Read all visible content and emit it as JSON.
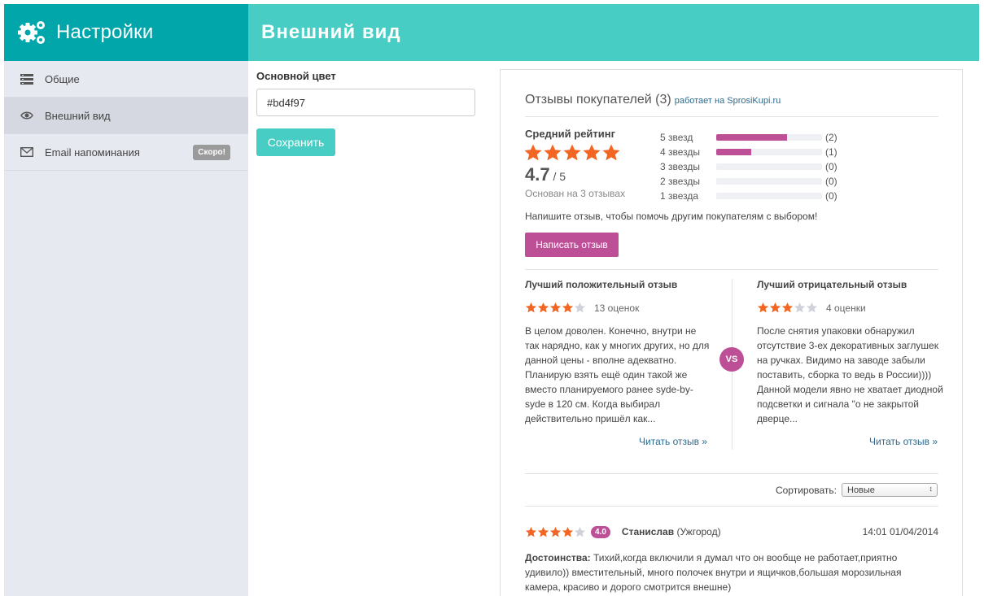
{
  "sidebar": {
    "title": "Настройки",
    "items": [
      {
        "label": "Общие",
        "icon": "list-icon"
      },
      {
        "label": "Внешний вид",
        "icon": "eye-icon",
        "active": true
      },
      {
        "label": "Email напоминания",
        "icon": "mail-icon",
        "badge": "Скоро!"
      }
    ]
  },
  "header": {
    "title": "Внешний вид"
  },
  "form": {
    "color_label": "Основной цвет",
    "color_value": "#bd4f97",
    "save_label": "Сохранить"
  },
  "widget": {
    "title": "Отзывы покупателей (3)",
    "powered": "работает на SprosiKupi.ru",
    "accent_color": "#bd4f97",
    "star_color": "#f26522",
    "avg_label": "Средний рейтинг",
    "avg_score": "4.7",
    "avg_of": " / 5",
    "avg_stars": 5,
    "based_on": "Основан на 3 отзывах",
    "distribution": [
      {
        "label": "5 звезд",
        "count": "(2)",
        "fraction": 0.67
      },
      {
        "label": "4 звезды",
        "count": "(1)",
        "fraction": 0.33
      },
      {
        "label": "3 звезды",
        "count": "(0)",
        "fraction": 0
      },
      {
        "label": "2 звезды",
        "count": "(0)",
        "fraction": 0
      },
      {
        "label": "1 звезда",
        "count": "(0)",
        "fraction": 0
      }
    ],
    "write_text": "Напишите отзыв, чтобы помочь другим покупателям с выбором!",
    "write_button": "Написать отзыв",
    "best_positive": {
      "title": "Лучший положительный отзыв",
      "stars": 4,
      "count": "13 оценок",
      "text": "В целом доволен. Конечно, внутри не так нарядно, как у многих других, но для данной цены - вполне адекватно. Планирую взять ещё один такой же вместо планируемого ранее syde-by-syde в 120 см. Когда выбирал действительно пришёл как...",
      "read_more": "Читать отзыв »"
    },
    "best_negative": {
      "title": "Лучший отрицательный отзыв",
      "stars": 3,
      "count": "4 оценки",
      "text": "После снятия упаковки обнаружил отсутствие 3-ех декоративных заглушек на ручках. Видимо на заводе забыли поставить, сборка то ведь в России)))) Данной модели явно не хватает диодной подсветки и сигнала \"о не закрытой дверце...",
      "read_more": "Читать отзыв »"
    },
    "vs": "VS",
    "sort_label": "Сортировать:",
    "sort_value": "Новые",
    "review": {
      "stars": 4,
      "rating": "4.0",
      "author": "Станислав",
      "city": "(Ужгород)",
      "date": "14:01 01/04/2014",
      "pros_label": "Достоинства:",
      "pros_text": " Тихий,когда включили я думал что он вообще не работает,приятно удивило)) вместительный, много полочек внутри и ящичков,большая морозильная камера, красиво и дорого смотрится внешне)"
    }
  }
}
